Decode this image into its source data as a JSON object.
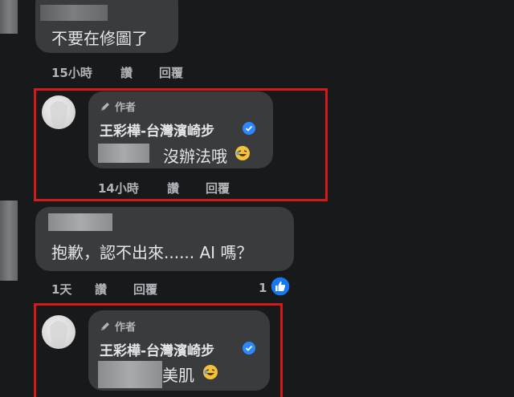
{
  "comments": [
    {
      "message": "不要在修圖了",
      "meta": {
        "time": "15小時",
        "like": "讚",
        "reply": "回覆"
      }
    },
    {
      "author_tag": "作者",
      "name": "王彩樺-台灣濱崎步",
      "message": "沒辦法哦",
      "meta": {
        "time": "14小時",
        "like": "讚",
        "reply": "回覆"
      }
    },
    {
      "message": "抱歉，認不出來...... AI 嗎？",
      "meta": {
        "time": "1天",
        "like": "讚",
        "reply": "回覆",
        "reaction_count": "1"
      }
    },
    {
      "author_tag": "作者",
      "name": "王彩樺-台灣濱崎步",
      "message": "美肌"
    }
  ],
  "colors": {
    "background": "#18191a",
    "bubble": "#3a3b3c",
    "highlight_border": "#d21a1a",
    "verified_blue": "#2d88ff",
    "like_blue": "#1877f2"
  },
  "icons": [
    "pencil-icon",
    "verified-badge-icon",
    "laughing-emoji-icon",
    "like-reaction-icon"
  ]
}
